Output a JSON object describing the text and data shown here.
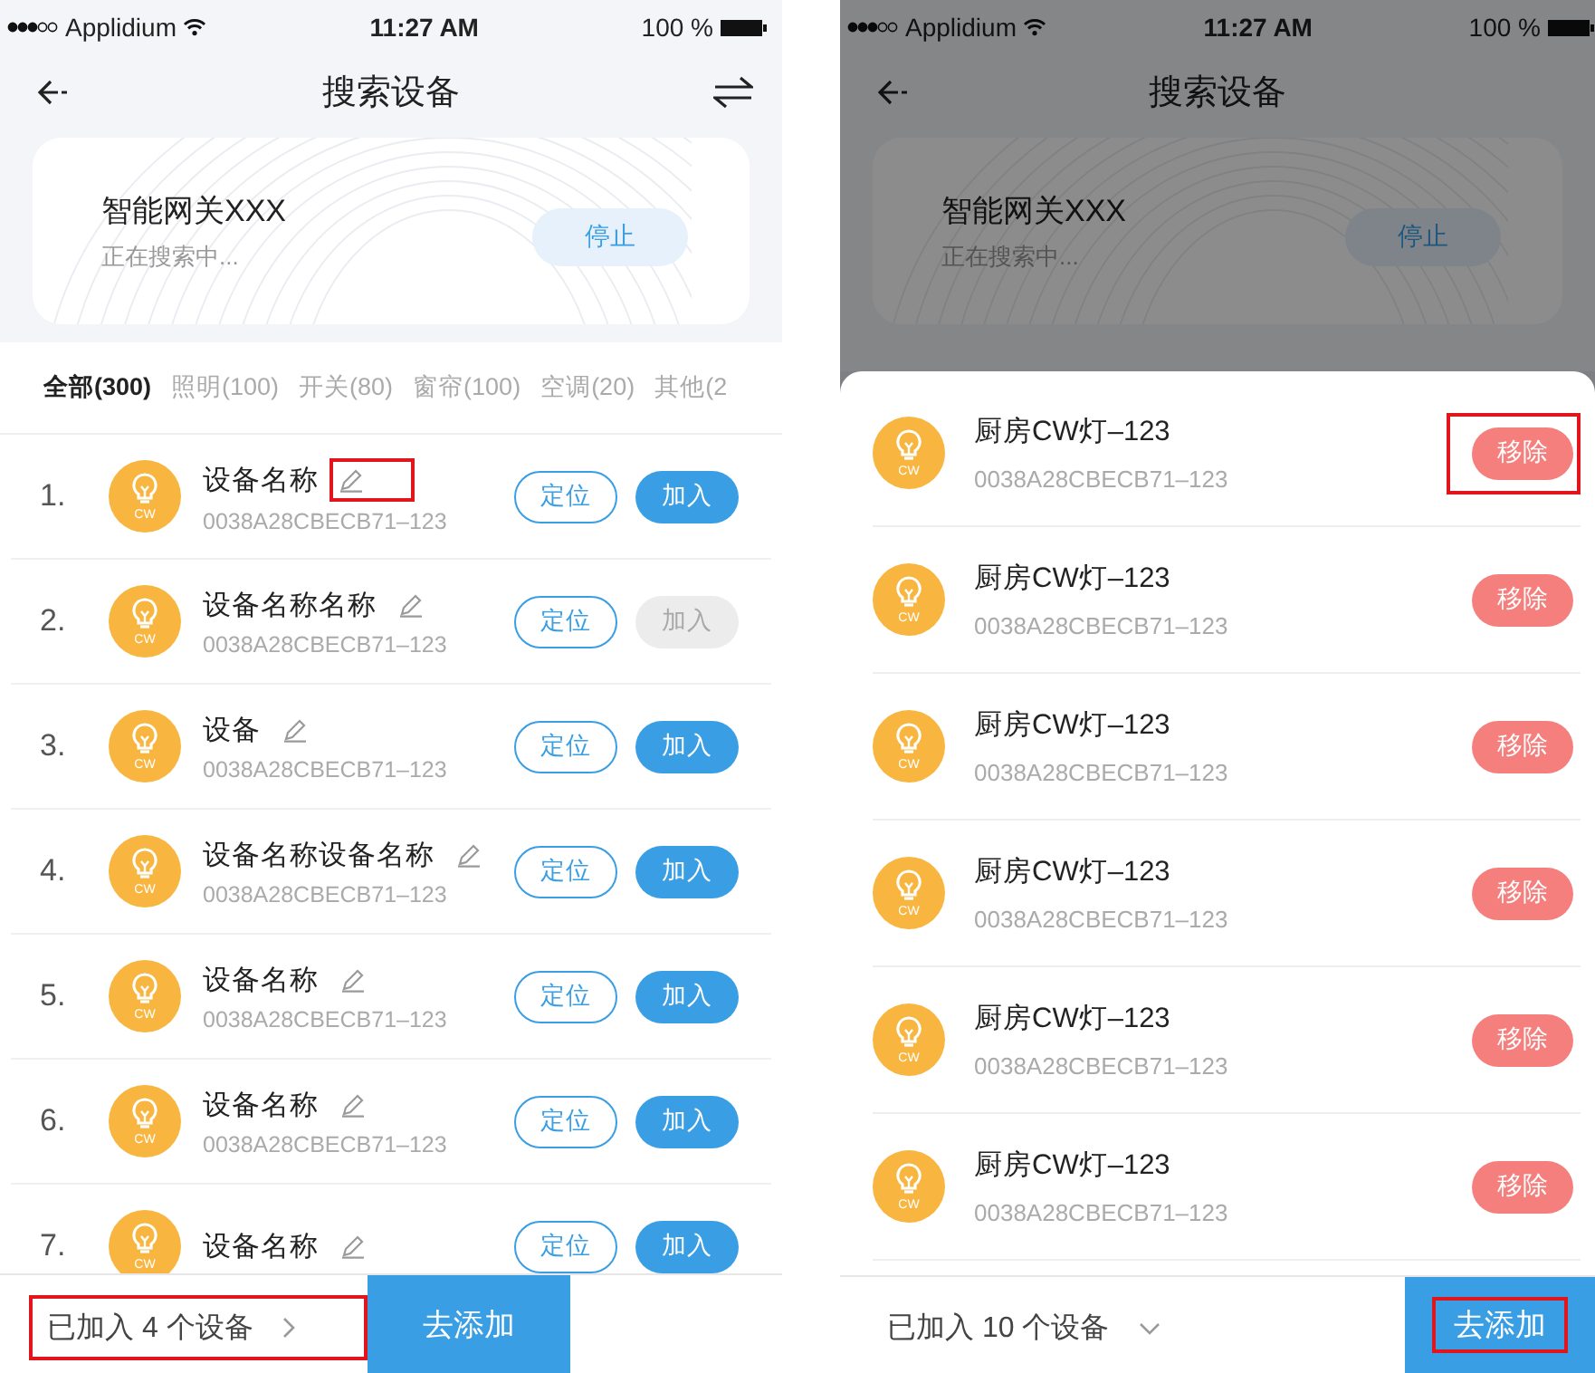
{
  "screens": [
    {
      "kind": "search",
      "dimmed": false,
      "status_bar": {
        "carrier": "Applidium",
        "time": "11:27 AM",
        "battery": "100 %"
      },
      "nav": {
        "title": "搜索设备"
      },
      "gateway": {
        "name": "智能网关XXX",
        "status": "正在搜索中...",
        "stop_button": "停止"
      },
      "tabs": [
        {
          "label": "全部(300)",
          "selected": true
        },
        {
          "label": "照明(100)",
          "selected": false
        },
        {
          "label": "开关(80)",
          "selected": false
        },
        {
          "label": "窗帘(100)",
          "selected": false
        },
        {
          "label": "空调(20)",
          "selected": false
        },
        {
          "label": "其他(2",
          "selected": false
        }
      ],
      "devices": [
        {
          "index": "1.",
          "name": "设备名称",
          "badge": "CW",
          "mac": "0038A28CBECB71–123",
          "locate_button": "定位",
          "add_button": "加入",
          "disabled": false,
          "highlighted": true
        },
        {
          "index": "2.",
          "name": "设备名称名称",
          "badge": "CW",
          "mac": "0038A28CBECB71–123",
          "locate_button": "定位",
          "add_button": "加入",
          "disabled": true,
          "highlighted": false
        },
        {
          "index": "3.",
          "name": "设备",
          "badge": "CW",
          "mac": "0038A28CBECB71–123",
          "locate_button": "定位",
          "add_button": "加入",
          "disabled": false,
          "highlighted": false
        },
        {
          "index": "4.",
          "name": "设备名称设备名称",
          "badge": "CW",
          "mac": "0038A28CBECB71–123",
          "locate_button": "定位",
          "add_button": "加入",
          "disabled": false,
          "highlighted": false
        },
        {
          "index": "5.",
          "name": "设备名称",
          "badge": "CW",
          "mac": "0038A28CBECB71–123",
          "locate_button": "定位",
          "add_button": "加入",
          "disabled": false,
          "highlighted": false
        },
        {
          "index": "6.",
          "name": "设备名称",
          "badge": "CW",
          "mac": "0038A28CBECB71–123",
          "locate_button": "定位",
          "add_button": "加入",
          "disabled": false,
          "highlighted": false
        },
        {
          "index": "7.",
          "name": "设备名称",
          "badge": "CW",
          "locate_button": "定位",
          "add_button": "加入",
          "disabled": false,
          "highlighted": false
        }
      ],
      "footer": {
        "summary": "已加入 4 个设备",
        "expanded": false,
        "highlighted": true,
        "action_button": "去添加",
        "action_highlighted": false
      }
    },
    {
      "kind": "added",
      "dimmed": true,
      "status_bar": {
        "carrier": "Applidium",
        "time": "11:27 AM",
        "battery": "100 %"
      },
      "nav": {
        "title": "搜索设备"
      },
      "gateway": {
        "name": "智能网关XXX",
        "status": "正在搜索中...",
        "stop_button": "停止"
      },
      "added_devices": [
        {
          "name": "厨房CW灯–123",
          "badge": "CW",
          "mac": "0038A28CBECB71–123",
          "remove_button": "移除",
          "highlighted": true
        },
        {
          "name": "厨房CW灯–123",
          "badge": "CW",
          "mac": "0038A28CBECB71–123",
          "remove_button": "移除",
          "highlighted": false
        },
        {
          "name": "厨房CW灯–123",
          "badge": "CW",
          "mac": "0038A28CBECB71–123",
          "remove_button": "移除",
          "highlighted": false
        },
        {
          "name": "厨房CW灯–123",
          "badge": "CW",
          "mac": "0038A28CBECB71–123",
          "remove_button": "移除",
          "highlighted": false
        },
        {
          "name": "厨房CW灯–123",
          "badge": "CW",
          "mac": "0038A28CBECB71–123",
          "remove_button": "移除",
          "highlighted": false
        },
        {
          "name": "厨房CW灯–123",
          "badge": "CW",
          "mac": "0038A28CBECB71–123",
          "remove_button": "移除",
          "highlighted": false
        }
      ],
      "footer": {
        "summary": "已加入 10 个设备",
        "expanded": true,
        "highlighted": false,
        "action_button": "去添加",
        "action_highlighted": true
      }
    }
  ]
}
